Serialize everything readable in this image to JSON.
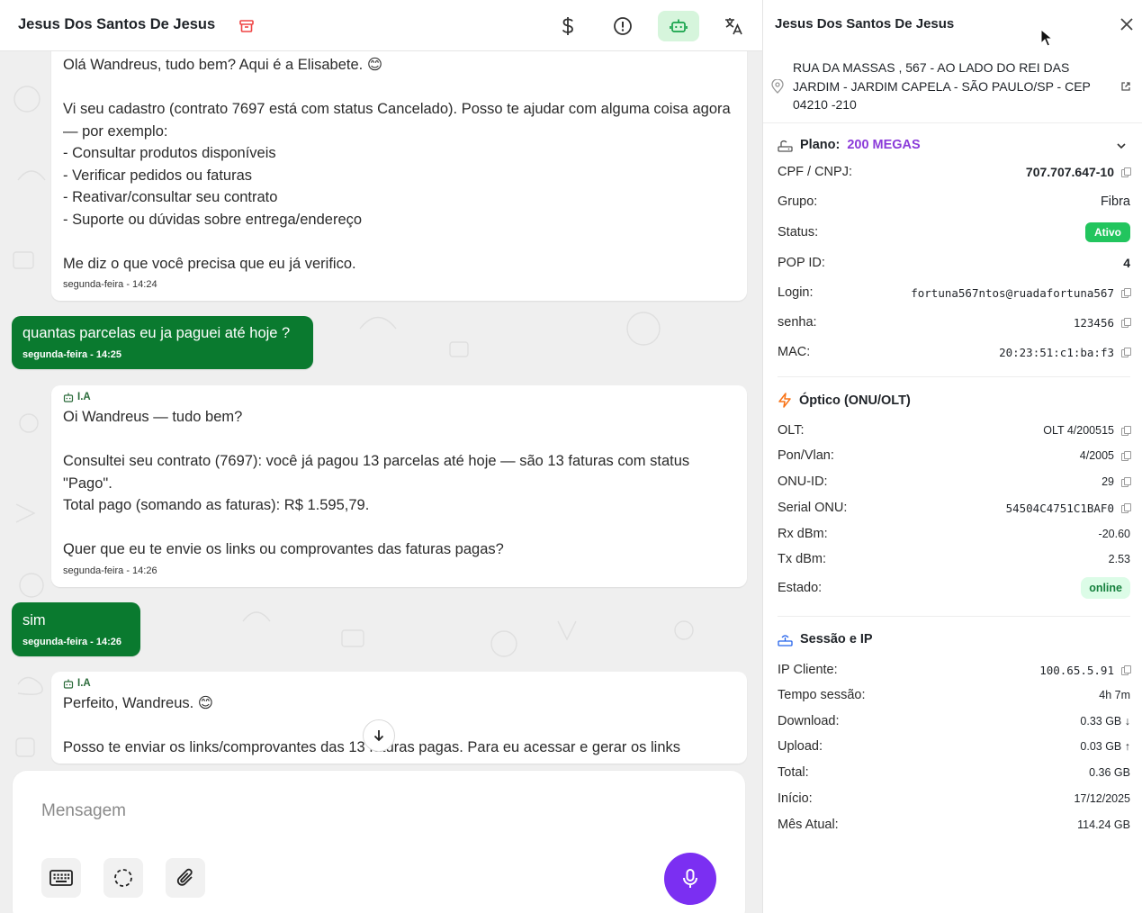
{
  "chat": {
    "header": {
      "title": "Jesus Dos Santos De Jesus",
      "icons": [
        "archive-icon",
        "dollar-icon",
        "alert-icon",
        "bot-icon",
        "translate-icon"
      ]
    },
    "messages": [
      {
        "text": "Olá Wandreus, tudo bem? Aqui é a Elisabete. 😊\n\nVi seu cadastro (contrato 7697 está com status Cancelado). Posso te ajudar com alguma coisa agora — por exemplo:\n- Consultar produtos disponíveis\n- Verificar pedidos ou faturas\n- Reativar/consultar seu contrato\n- Suporte ou dúvidas sobre entrega/endereço\n\nMe diz o que você precisa que eu já verifico.",
        "time": "segunda-feira - 14:24"
      },
      {
        "text": "quantas parcelas eu ja paguei até hoje ?",
        "time": "segunda-feira - 14:25"
      },
      {
        "tag": "I.A",
        "text": "Oi Wandreus — tudo bem?\n\nConsultei seu contrato (7697): você já pagou 13 parcelas até hoje — são 13 faturas com status \"Pago\".\nTotal pago (somando as faturas): R$ 1.595,79.\n\nQuer que eu te envie os links ou comprovantes das faturas pagas?",
        "time": "segunda-feira - 14:26"
      },
      {
        "text": "sim",
        "time": "segunda-feira - 14:26"
      },
      {
        "tag": "I.A",
        "text": "Perfeito, Wandreus. 😊\n\nPosso te enviar os links/comprovantes das 13 faturas pagas. Para eu acessar e gerar os links"
      }
    ],
    "composer": {
      "placeholder": "Mensagem"
    }
  },
  "panel": {
    "title": "Jesus Dos Santos De Jesus",
    "address": "RUA DA MASSAS , 567 - AO LADO DO REI DAS JARDIM - JARDIM CAPELA - SÃO PAULO/SP - CEP 04210 -210",
    "plan": {
      "label": "Plano:",
      "value": "200 MEGAS"
    },
    "fields": [
      {
        "label": "CPF / CNPJ:",
        "value": "707.707.647-10",
        "copy": true
      },
      {
        "label": "Grupo:",
        "value": "Fibra"
      },
      {
        "label": "Status:",
        "value": "Ativo"
      },
      {
        "label": "POP ID:",
        "value": "4"
      },
      {
        "label": "Login:",
        "value": "fortuna567ntos@ruadafortuna567",
        "copy": true
      },
      {
        "label": "senha:",
        "value": "123456",
        "copy": true
      },
      {
        "label": "MAC:",
        "value": "20:23:51:c1:ba:f3",
        "copy": true
      }
    ],
    "optic": {
      "title": "Óptico (ONU/OLT)",
      "fields": [
        {
          "label": "OLT:",
          "value": "OLT 4/200515",
          "copy": true
        },
        {
          "label": "Pon/Vlan:",
          "value": "4/2005",
          "copy": true
        },
        {
          "label": "ONU-ID:",
          "value": "29",
          "copy": true
        },
        {
          "label": "Serial ONU:",
          "value": "54504C4751C1BAF0",
          "copy": true
        },
        {
          "label": "Rx dBm:",
          "value": "-20.60"
        },
        {
          "label": "Tx dBm:",
          "value": "2.53"
        },
        {
          "label": "Estado:",
          "value": "online"
        }
      ]
    },
    "session": {
      "title": "Sessão e IP",
      "fields": [
        {
          "label": "IP Cliente:",
          "value": "100.65.5.91",
          "copy": true
        },
        {
          "label": "Tempo sessão:",
          "value": "4h 7m"
        },
        {
          "label": "Download:",
          "value": "0.33 GB ↓",
          "color": "#16a34a"
        },
        {
          "label": "Upload:",
          "value": "0.03 GB ↑",
          "color": "#2563eb"
        },
        {
          "label": "Total:",
          "value": "0.36 GB"
        },
        {
          "label": "Início:",
          "value": "17/12/2025"
        },
        {
          "label": "Mês Atual:",
          "value": "114.24 GB"
        }
      ]
    }
  }
}
